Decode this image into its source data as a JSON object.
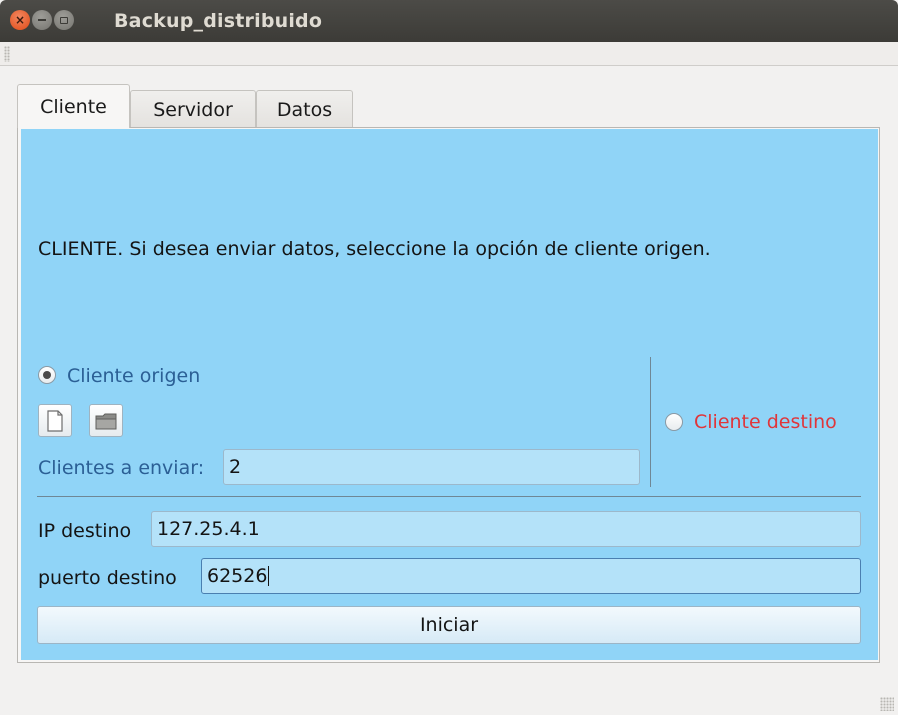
{
  "window": {
    "title": "Backup_distribuido"
  },
  "tabs": [
    {
      "label": "Cliente",
      "active": true
    },
    {
      "label": "Servidor",
      "active": false
    },
    {
      "label": "Datos",
      "active": false
    }
  ],
  "cliente": {
    "instruction": "CLIENTE. Si desea enviar datos, seleccione la opción de cliente origen.",
    "origen": {
      "label": "Cliente origen",
      "selected": true
    },
    "destino": {
      "label": "Cliente destino",
      "selected": false
    },
    "icons": {
      "new_file": "new-file-icon",
      "open_folder": "folder-icon"
    },
    "clientes_a_enviar": {
      "label": "Clientes a enviar:",
      "value": "2"
    },
    "ip_destino": {
      "label": "IP destino",
      "value": "127.25.4.1"
    },
    "puerto_destino": {
      "label": "puerto destino",
      "value": "62526"
    },
    "start_button": "Iniciar"
  },
  "colors": {
    "panel_bg": "#90d4f7",
    "label_blue": "#2b5f95",
    "label_red": "#e0353a",
    "titlebar": "#3c3b37"
  }
}
